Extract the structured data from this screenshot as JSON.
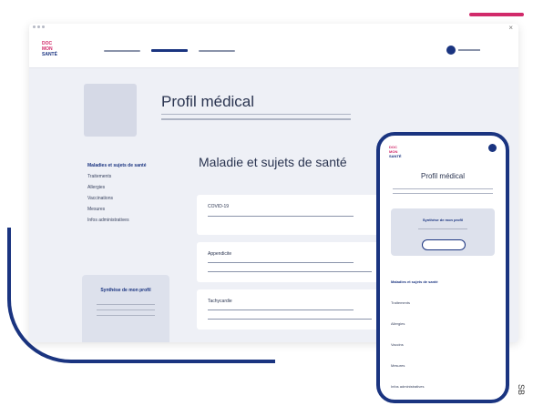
{
  "app": {
    "logo_line1": "DOC",
    "logo_line2": "MON",
    "logo_line3": "SANTÉ"
  },
  "colors": {
    "accent": "#1a3480",
    "brand_pink": "#d12a6a",
    "background_panel": "#eef0f6",
    "card": "#dde1ec"
  },
  "desktop": {
    "page_title": "Profil médical",
    "section_title": "Maladie et sujets de santé",
    "sidebar": {
      "items": [
        {
          "label": "Maladies et sujets de santé",
          "active": true
        },
        {
          "label": "Traitements",
          "active": false
        },
        {
          "label": "Allergies",
          "active": false
        },
        {
          "label": "Vaccinations",
          "active": false
        },
        {
          "label": "Mesures",
          "active": false
        },
        {
          "label": "Infos administratives",
          "active": false
        }
      ]
    },
    "synthesis_card_title": "Synthèse de mon profil",
    "items": [
      {
        "label": "COVID-19"
      },
      {
        "label": "Appendicite"
      },
      {
        "label": "Tachycardie"
      }
    ]
  },
  "mobile": {
    "page_title": "Profil médical",
    "synthesis_card_title": "Synthèse de mon profil",
    "menu": [
      {
        "label": "Maladies et sujets de santé",
        "active": true
      },
      {
        "label": "Traitements",
        "active": false
      },
      {
        "label": "Allergies",
        "active": false
      },
      {
        "label": "Vaccins",
        "active": false
      },
      {
        "label": "Mesures",
        "active": false
      },
      {
        "label": "Infos administratives",
        "active": false
      }
    ]
  },
  "side_mark": "SB"
}
